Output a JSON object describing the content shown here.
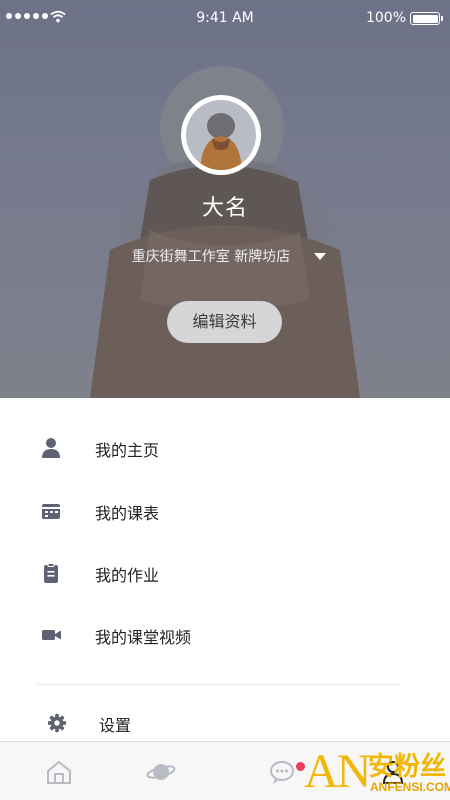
{
  "status_bar": {
    "time": "9:41 AM",
    "battery": "100%"
  },
  "profile": {
    "name": "大名",
    "studio": "重庆街舞工作室 新牌坊店",
    "edit_button": "编辑资料"
  },
  "menu": {
    "items": [
      {
        "label": "我的主页",
        "icon": "person-icon"
      },
      {
        "label": "我的课表",
        "icon": "schedule-icon"
      },
      {
        "label": "我的作业",
        "icon": "clipboard-icon"
      },
      {
        "label": "我的课堂视频",
        "icon": "video-camera-icon"
      }
    ],
    "settings": {
      "label": "设置",
      "icon": "gear-icon"
    }
  },
  "tabbar": {
    "tabs": [
      {
        "icon": "home-icon"
      },
      {
        "icon": "planet-icon"
      },
      {
        "icon": "chat-bubble-icon"
      },
      {
        "icon": "profile-icon"
      }
    ]
  },
  "watermark": {
    "brand": "AN",
    "name": "安粉丝",
    "url": "ANFENSI.COM"
  },
  "colors": {
    "accent_text": "#222222",
    "icon_gray": "#5f6272",
    "badge": "#ee3a5f",
    "watermark": "#f2b705"
  }
}
